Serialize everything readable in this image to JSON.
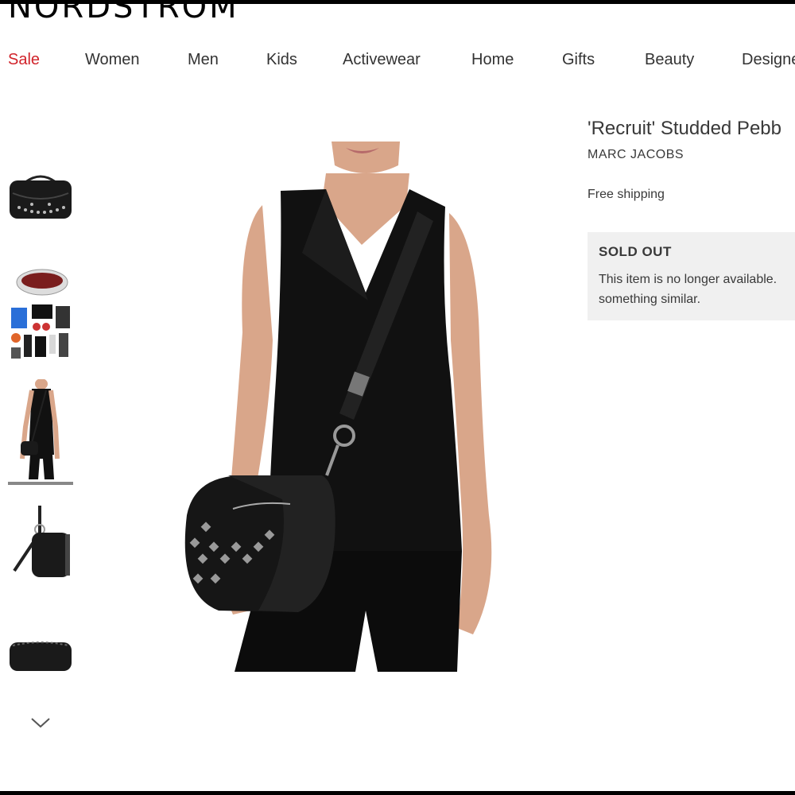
{
  "header": {
    "logo": "NORDSTROM"
  },
  "nav": {
    "items": [
      "Sale",
      "Women",
      "Men",
      "Kids",
      "Activewear",
      "Home",
      "Gifts",
      "Beauty",
      "Designe"
    ]
  },
  "thumbnails": {
    "count": 5,
    "selected_index": 2,
    "icons": [
      "bag-front-thumbnail",
      "bag-interior-thumbnail",
      "model-wearing-thumbnail",
      "bag-side-thumbnail",
      "bag-bottom-thumbnail"
    ]
  },
  "product": {
    "title": "'Recruit' Studded Pebb",
    "brand": "MARC JACOBS",
    "shipping": "Free shipping",
    "status_title": "SOLD OUT",
    "status_message": "This item is no longer available.\nsomething similar."
  },
  "colors": {
    "sale_red": "#d1232a",
    "status_box_bg": "#f0f0f0",
    "text": "#393939"
  }
}
